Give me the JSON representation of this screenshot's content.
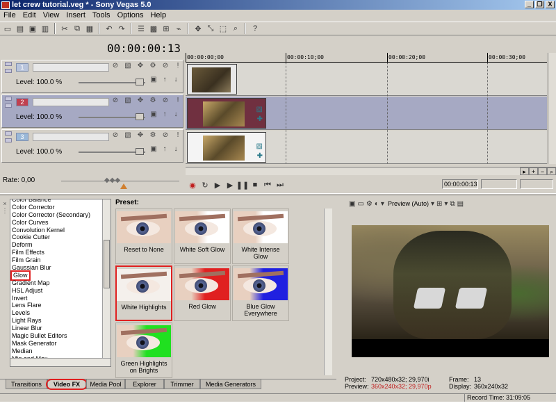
{
  "window": {
    "title": "let crew tutorial.veg * - Sony Vegas 5.0",
    "buttons": [
      "_",
      "❒",
      "X"
    ]
  },
  "menu": [
    "File",
    "Edit",
    "View",
    "Insert",
    "Tools",
    "Options",
    "Help"
  ],
  "timeline": {
    "timecode": "00:00:00:13",
    "ruler": [
      "00:00:00;00",
      "00:00:10;00",
      "00:00:20;00",
      "00:00:30;00"
    ],
    "tracks": [
      {
        "num": "1",
        "level": "Level: 100.0 %"
      },
      {
        "num": "2",
        "level": "Level: 100.0 %"
      },
      {
        "num": "3",
        "level": "Level: 100.0 %"
      }
    ]
  },
  "rate": {
    "label": "Rate: 0,00"
  },
  "transport": {
    "timecode": "00:00:00:13"
  },
  "fx_list": [
    "Color Balance",
    "Color Corrector",
    "Color Corrector (Secondary)",
    "Color Curves",
    "Convolution Kernel",
    "Cookie Cutter",
    "Deform",
    "Film Effects",
    "Film Grain",
    "Gaussian Blur",
    "Glow",
    "Gradient Map",
    "HSL Adjust",
    "Invert",
    "Lens Flare",
    "Levels",
    "Light Rays",
    "Linear Blur",
    "Magic Bullet Editors",
    "Mask Generator",
    "Median",
    "Min and Max",
    "Mirror"
  ],
  "preset": {
    "label": "Preset:",
    "items": [
      {
        "name": "Reset to None",
        "tint": "none"
      },
      {
        "name": "White Soft Glow",
        "tint": "white-soft"
      },
      {
        "name": "White Intense Glow",
        "tint": "white-intense"
      },
      {
        "name": "White Highlights",
        "tint": "white"
      },
      {
        "name": "Red Glow",
        "tint": "#e02020"
      },
      {
        "name": "Blue Glow Everywhere",
        "tint": "#2020e0"
      },
      {
        "name": "Green Highlights on Brights",
        "tint": "#20e020"
      }
    ]
  },
  "tabs": [
    "Transitions",
    "Video FX",
    "Media Pool",
    "Explorer",
    "Trimmer",
    "Media Generators"
  ],
  "preview": {
    "mode": "Preview (Auto)",
    "project_label": "Project:",
    "project_value": "720x480x32; 29,970i",
    "preview_label": "Preview:",
    "preview_value": "360x240x32; 29,970p",
    "frame_label": "Frame:",
    "frame_value": "13",
    "display_label": "Display:",
    "display_value": "360x240x32"
  },
  "status": {
    "record_time": "Record Time: 31:09:05"
  }
}
